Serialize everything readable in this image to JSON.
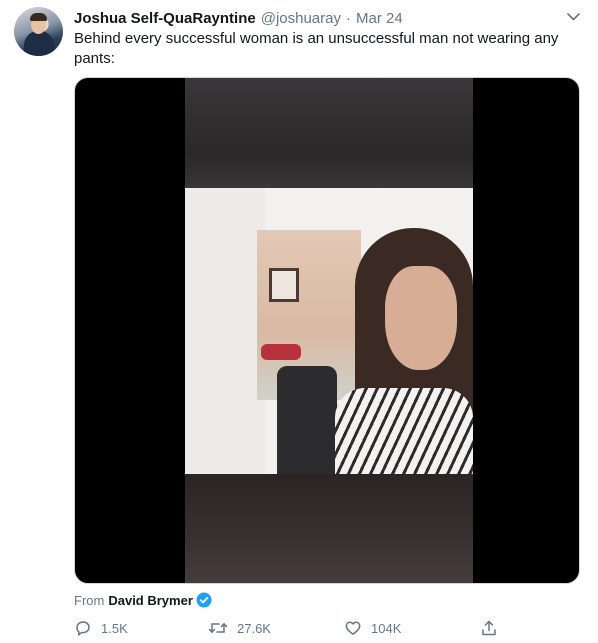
{
  "tweet": {
    "author_name": "Joshua Self-QuaRayntine",
    "handle": "@joshuaray",
    "separator": "·",
    "date": "Mar 24",
    "text": "Behind every successful woman is an unsuccessful man not wearing any pants:",
    "caret_icon": "chevron-down-icon"
  },
  "media": {
    "type": "video",
    "attribution_label": "From",
    "attribution_name": "David Brymer",
    "attribution_verified": true
  },
  "actions": {
    "reply_count": "1.5K",
    "retweet_count": "27.6K",
    "like_count": "104K",
    "reply_icon": "reply-icon",
    "retweet_icon": "retweet-icon",
    "like_icon": "heart-icon",
    "share_icon": "share-icon"
  },
  "colors": {
    "text": "#14171a",
    "secondary": "#657786",
    "verified_blue": "#1da1f2"
  }
}
